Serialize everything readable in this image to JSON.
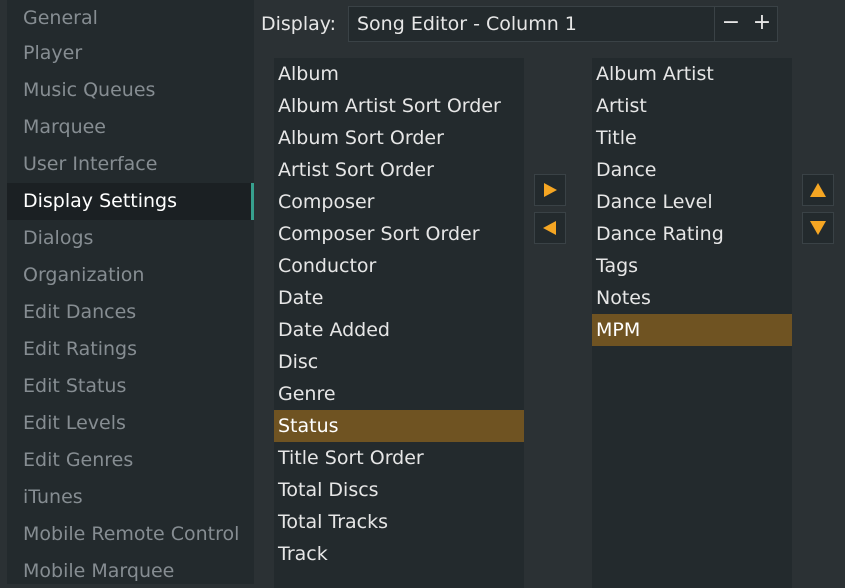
{
  "sidebar": {
    "items": [
      {
        "label": "General"
      },
      {
        "label": "Player"
      },
      {
        "label": "Music Queues"
      },
      {
        "label": "Marquee"
      },
      {
        "label": "User Interface"
      },
      {
        "label": "Display Settings"
      },
      {
        "label": "Dialogs"
      },
      {
        "label": "Organization"
      },
      {
        "label": "Edit Dances"
      },
      {
        "label": "Edit Ratings"
      },
      {
        "label": "Edit Status"
      },
      {
        "label": "Edit Levels"
      },
      {
        "label": "Edit Genres"
      },
      {
        "label": "iTunes"
      },
      {
        "label": "Mobile Remote Control"
      },
      {
        "label": "Mobile Marquee"
      }
    ],
    "active_index": 5
  },
  "display": {
    "label": "Display:",
    "value": "Song Editor - Column 1",
    "minus_label": "−",
    "plus_label": "+"
  },
  "available_list": {
    "items": [
      "Album",
      "Album Artist Sort Order",
      "Album Sort Order",
      "Artist Sort Order",
      "Composer",
      "Composer Sort Order",
      "Conductor",
      "Date",
      "Date Added",
      "Disc",
      "Genre",
      "Status",
      "Title Sort Order",
      "Total Discs",
      "Total Tracks",
      "Track"
    ],
    "selected_index": 11
  },
  "selected_list": {
    "items": [
      "Album Artist",
      "Artist",
      "Title",
      "Dance",
      "Dance Level",
      "Dance Rating",
      "Tags",
      "Notes",
      "MPM"
    ],
    "selected_index": 8
  },
  "icons": {
    "move_right": "triangle-right-icon",
    "move_left": "triangle-left-icon",
    "move_up": "triangle-up-icon",
    "move_down": "triangle-down-icon"
  },
  "colors": {
    "accent": "#37a08e",
    "selection": "#6f5322",
    "arrow": "#f5a623"
  }
}
